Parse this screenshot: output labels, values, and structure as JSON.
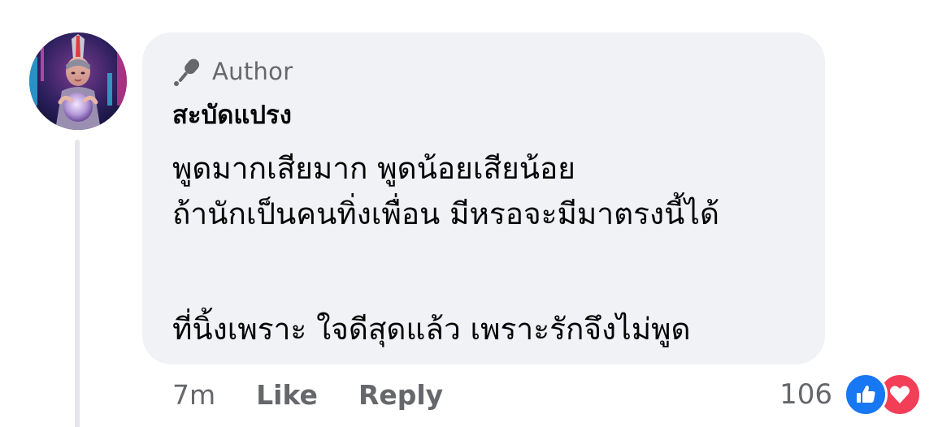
{
  "comment": {
    "badge_label": "Author",
    "author_name": "สะบัดแปรง",
    "lines": [
      "พูดมากเสียมาก พูดน้อยเสียน้อย",
      "ถ้านักเป็นคนทิ่งเพื่อน มีหรอจะมีมาตรงนี้ได้",
      "",
      "ที่นิ้งเพราะ ใจดีสุดแล้ว เพราะรักจึงไม่พูด"
    ]
  },
  "actions": {
    "timestamp": "7m",
    "like_label": "Like",
    "reply_label": "Reply"
  },
  "reactions": {
    "count": "106",
    "types": [
      "like-icon",
      "love-icon"
    ]
  },
  "colors": {
    "bubble_bg": "#f0f2f5",
    "secondary_text": "#65676b",
    "primary_text": "#050505",
    "like_blue": "#1877f2",
    "love_red": "#f33e58"
  }
}
